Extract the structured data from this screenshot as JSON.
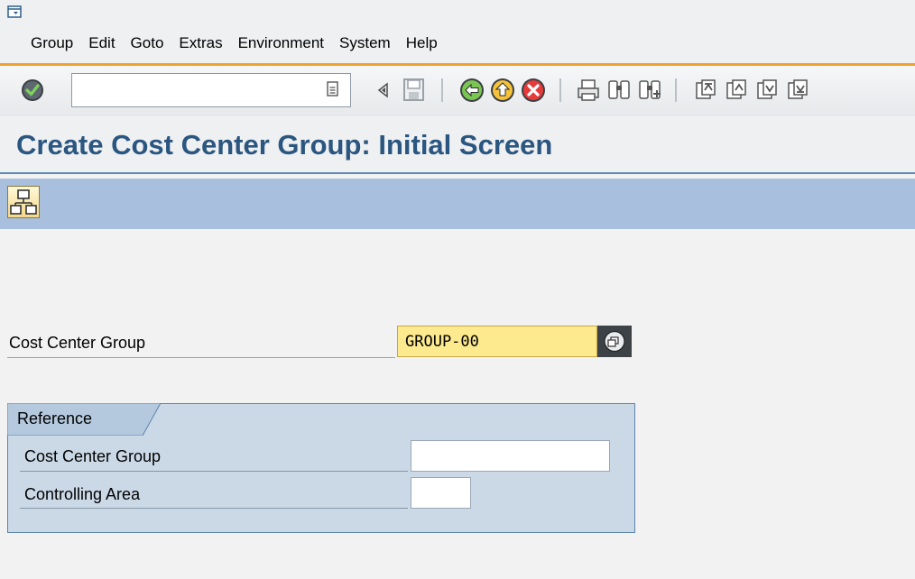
{
  "menubar": {
    "items": [
      "Group",
      "Edit",
      "Goto",
      "Extras",
      "Environment",
      "System",
      "Help"
    ]
  },
  "toolbar": {
    "command_field_value": ""
  },
  "page": {
    "title": "Create Cost Center Group: Initial Screen"
  },
  "main": {
    "group_label": "Cost Center Group",
    "group_value": "GROUP-00"
  },
  "reference": {
    "title": "Reference",
    "group_label": "Cost Center Group",
    "group_value": "",
    "area_label": "Controlling Area",
    "area_value": ""
  },
  "colors": {
    "accent_orange": "#f0a22b",
    "title_blue": "#2b5680",
    "app_toolbar": "#a8c0dd",
    "required_field": "#fde98e",
    "frame_bg": "#cbd9e7"
  },
  "icons": [
    "menu-dropdown-icon",
    "enter-check-icon",
    "command-history-icon",
    "triangle-left-icon",
    "save-icon",
    "back-icon",
    "exit-icon",
    "cancel-icon",
    "print-icon",
    "find-icon",
    "find-next-icon",
    "first-page-icon",
    "previous-page-icon",
    "next-page-icon",
    "last-page-icon",
    "hierarchy-icon",
    "multiple-selection-icon"
  ]
}
